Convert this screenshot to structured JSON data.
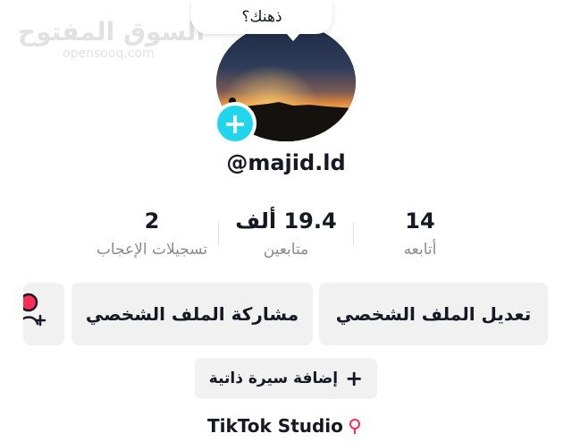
{
  "watermark": {
    "title": "السوق المفتوح",
    "subtitle": "opensooq.com"
  },
  "bubble": {
    "text": "ذهنك؟"
  },
  "profile": {
    "username": "@majid.ld"
  },
  "stats": [
    {
      "number": "14",
      "label": "أتابعه"
    },
    {
      "number": "19.4 ألف",
      "label": "متابعين"
    },
    {
      "number": "2",
      "label": "تسجيلات الإعجاب"
    }
  ],
  "buttons": {
    "edit_profile": "تعديل الملف الشخصي",
    "share_profile": "مشاركة الملف الشخصي",
    "add_bio": "إضافة سيرة ذاتية",
    "add_bio_icon": "+"
  },
  "studio": {
    "label": "TikTok Studio"
  },
  "colors": {
    "accent": "#20d5ec",
    "button_bg": "#f1f1f2",
    "muted_text": "#8a8b91",
    "pin": "#fe2c55"
  },
  "icons": {
    "add_user": "add-user-icon",
    "pin": "location-pin-icon",
    "plus": "plus-icon"
  }
}
